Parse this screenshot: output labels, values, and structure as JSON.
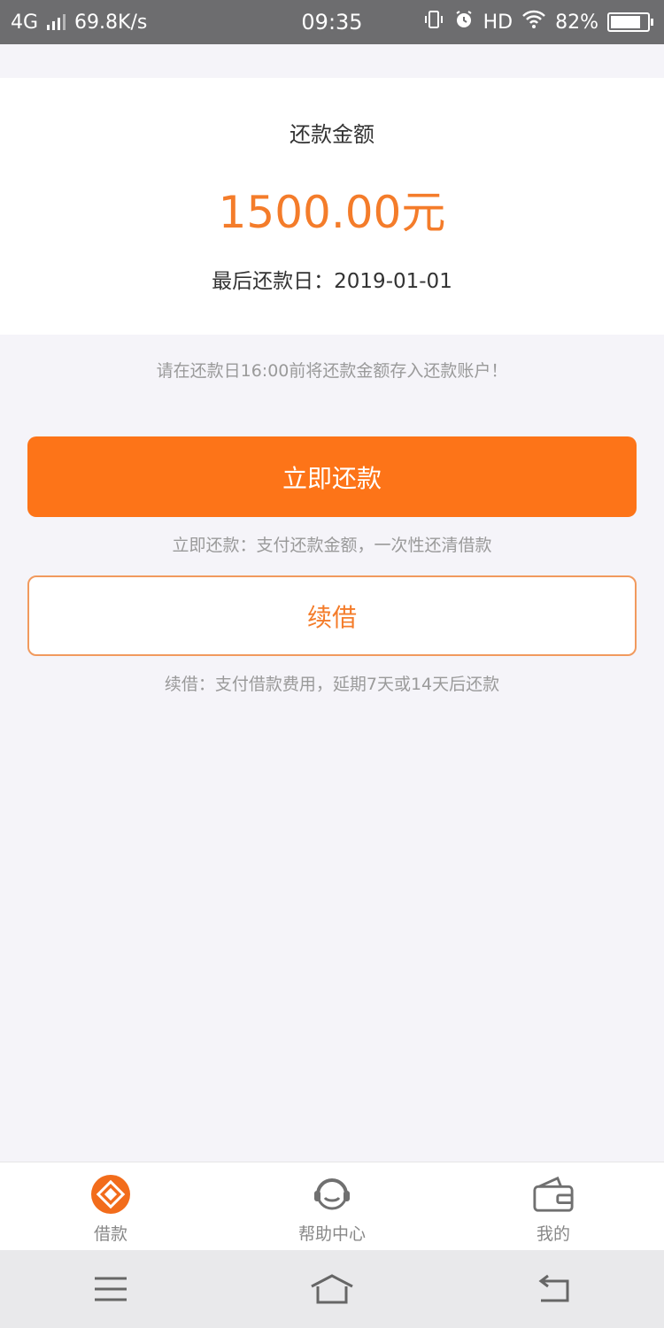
{
  "status_bar": {
    "network": "4G",
    "speed": "69.8K/s",
    "time": "09:35",
    "hd": "HD",
    "battery": "82%",
    "battery_level": 0.82,
    "icons": [
      "vibrate-icon",
      "alarm-icon",
      "wifi-icon"
    ]
  },
  "repayment": {
    "label": "还款金额",
    "amount": "1500.00元",
    "due_date": "最后还款日：2019-01-01"
  },
  "notice": "请在还款日16:00前将还款金额存入还款账户！",
  "actions": {
    "repay_label": "立即还款",
    "repay_desc": "立即还款：支付还款金额，一次性还清借款",
    "renew_label": "续借",
    "renew_desc": "续借：支付借款费用，延期7天或14天后还款"
  },
  "tabs": [
    {
      "label": "借款",
      "icon": "loan-icon",
      "active": true
    },
    {
      "label": "帮助中心",
      "icon": "headset-icon",
      "active": false
    },
    {
      "label": "我的",
      "icon": "wallet-icon",
      "active": false
    }
  ],
  "colors": {
    "accent": "#fd7418",
    "amount": "#f47c2a",
    "muted": "#9a9a9a"
  }
}
